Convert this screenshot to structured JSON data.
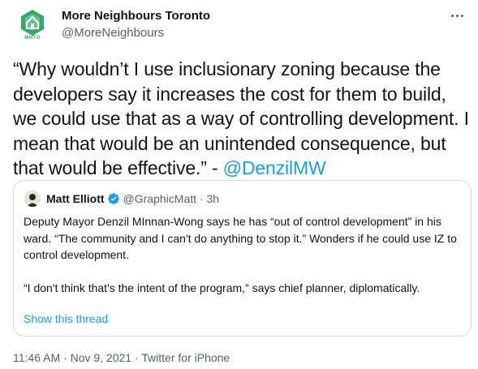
{
  "author": {
    "name": "More Neighbours Toronto",
    "handle": "@MoreNeighbours",
    "avatar_text": "MNTO",
    "avatar_color": "#3aa86b"
  },
  "tweet": {
    "text": "“Why wouldn’t I use inclusionary zoning because the developers say it increases the cost for them to build, we could use that as a way of controlling development. I mean that would be an unintended consequence, but that would be effective.” - ",
    "mention": "@DenzilMW"
  },
  "quote": {
    "name": "Matt Elliott",
    "handle": "@GraphicMatt",
    "separator": "·",
    "time": "3h",
    "verified_icon": "verified-badge-icon",
    "paragraphs": [
      "Deputy Mayor Denzil MInnan-Wong says he has “out of control development” in his ward. “The community and I can't do anything to stop it.” Wonders if he could use IZ to control development.",
      "“I don't think that's the intent of the program,” says chief planner, diplomatically."
    ],
    "show_thread": "Show this thread"
  },
  "meta": {
    "time": "11:46 AM",
    "sep1": "·",
    "date": "Nov 9, 2021",
    "sep2": "·",
    "source": "Twitter for iPhone"
  },
  "colors": {
    "accent": "#1d9bf0",
    "muted": "#536471",
    "border": "#cfd9de"
  }
}
